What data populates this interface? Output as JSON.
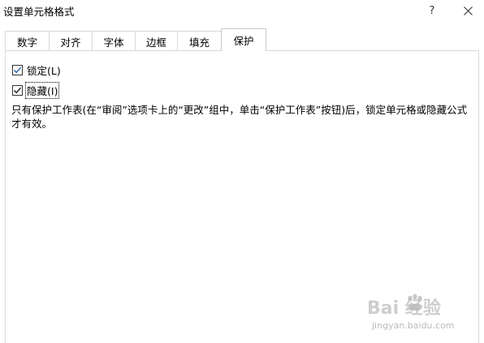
{
  "window": {
    "title": "设置单元格格式",
    "help_label": "?"
  },
  "tabs": [
    {
      "label": "数字",
      "active": false
    },
    {
      "label": "对齐",
      "active": false
    },
    {
      "label": "字体",
      "active": false
    },
    {
      "label": "边框",
      "active": false
    },
    {
      "label": "填充",
      "active": false
    },
    {
      "label": "保护",
      "active": true
    }
  ],
  "protection": {
    "locked": {
      "label": "锁定(L)",
      "checked": true
    },
    "hidden": {
      "label": "隐藏(I)",
      "checked": true
    },
    "description": "只有保护工作表(在“审阅”选项卡上的“更改”组中，单击“保护工作表”按钮)后，锁定单元格或隐藏公式才有效。"
  },
  "watermark": {
    "main": "Bai  经验",
    "sub": "jingyan.baidu.com"
  },
  "colors": {
    "checkbox_check": "#1f5fa8",
    "tab_border": "#d9d9d9"
  }
}
